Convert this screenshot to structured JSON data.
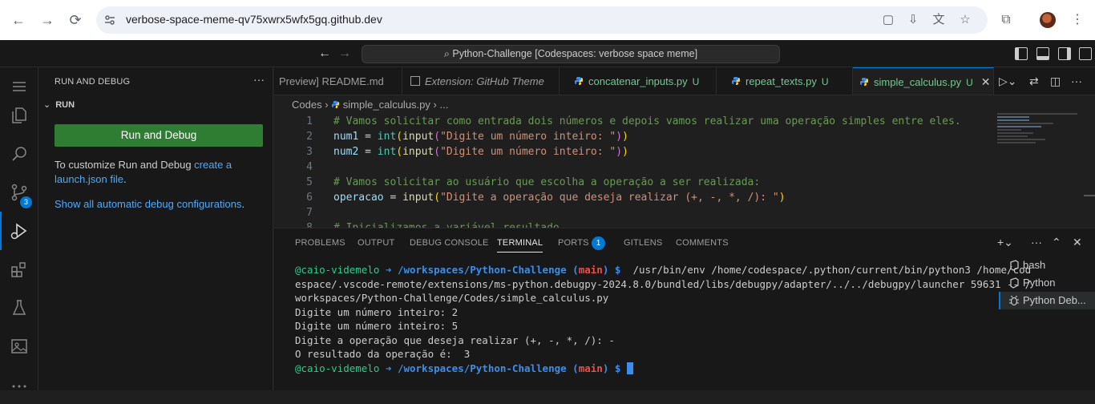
{
  "browser": {
    "url": "verbose-space-meme-qv75xwrx5wfx5gq.github.dev"
  },
  "titlebar": {
    "command_center": "Python-Challenge [Codespaces: verbose space meme]"
  },
  "activity": {
    "scm_badge": "3"
  },
  "sidebar": {
    "title": "RUN AND DEBUG",
    "section": "RUN",
    "run_button": "Run and Debug",
    "customize_text": "To customize Run and Debug",
    "create_link_1": "create a",
    "create_link_2": "launch.json file",
    "period": ".",
    "show_all_link": "Show all automatic debug configurations",
    "period2": "."
  },
  "tabs": [
    {
      "label": "Preview] README.md"
    },
    {
      "label": "Extension: GitHub Theme"
    },
    {
      "label": "concatenar_inputs.py",
      "status": "U"
    },
    {
      "label": "repeat_texts.py",
      "status": "U"
    },
    {
      "label": "simple_calculus.py",
      "status": "U"
    }
  ],
  "breadcrumb": {
    "folder": "Codes",
    "file": "simple_calculus.py",
    "more": "..."
  },
  "code": {
    "l1": "# Vamos solicitar como entrada dois números e depois vamos realizar uma operação simples entre eles.",
    "l2_var": "num1",
    "l3_var": "num2",
    "prompt_num": "\"Digite um número inteiro: \"",
    "l5": "# Vamos solicitar ao usuário que escolha a operação a ser realizada:",
    "l6_var": "operacao",
    "l6_str": "\"Digite a operação que deseja realizar (+, -, *, /): \"",
    "l8": "# Inicializamos a variável resultado"
  },
  "panel": {
    "tabs": [
      "PROBLEMS",
      "OUTPUT",
      "DEBUG CONSOLE",
      "TERMINAL",
      "PORTS",
      "GITLENS",
      "COMMENTS"
    ],
    "ports_badge": "1",
    "terminal": {
      "user": "@caio-videmelo",
      "arrow": " ➜ ",
      "path": "/workspaces/Python-Challenge",
      "branch_open": " (",
      "branch": "main",
      "branch_close": ") $ ",
      "cmd_1": " /usr/bin/env /home/codespace/.python/current/bin/python3 /home/cod",
      "cmd_2": "espace/.vscode-remote/extensions/ms-python.debugpy-2024.8.0/bundled/libs/debugpy/adapter/../../debugpy/launcher 59631 -- /",
      "cmd_3": "workspaces/Python-Challenge/Codes/simple_calculus.py",
      "out_1": "Digite um número inteiro: 2",
      "out_2": "Digite um número inteiro: 5",
      "out_3": "Digite a operação que deseja realizar (+, -, *, /): -",
      "out_4": "O resultado da operação é:  3"
    },
    "term_list": [
      "bash",
      "Python",
      "Python Deb..."
    ]
  }
}
